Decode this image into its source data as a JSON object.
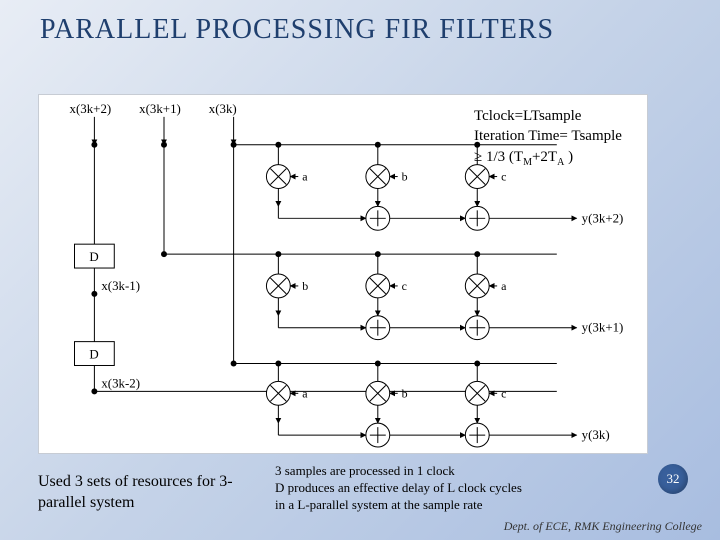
{
  "title": "PARALLEL PROCESSING FIR FILTERS",
  "equations": {
    "line1": "Tclock=LTsample",
    "line2_a": "Iteration Time= Tsample",
    "line2_b": "≥  1/3 (T",
    "line2_sub1": "M",
    "line2_c": "+2T",
    "line2_sub2": "A",
    "line2_d": " )"
  },
  "diagram": {
    "inputs": [
      "x(3k+2)",
      "x(3k+1)",
      "x(3k)"
    ],
    "delays": [
      "D",
      "D"
    ],
    "delay_out1": "x(3k-1)",
    "delay_out2": "x(3k-2)",
    "outputs": [
      "y(3k+2)",
      "y(3k+1)",
      "y(3k)"
    ],
    "coefs_row1": [
      "a",
      "b",
      "c"
    ],
    "coefs_row2": [
      "b",
      "c",
      "a"
    ],
    "coefs_row3": [
      "a",
      "b",
      "c"
    ]
  },
  "caption_left": "Used 3 sets of resources for 3-parallel system",
  "caption_right": "3 samples are processed in 1 clock\nD produces an effective delay of  L clock cycles\nin a L-parallel system at the sample rate",
  "page_number": "32",
  "footer": "Dept. of ECE, RMK Engineering College"
}
